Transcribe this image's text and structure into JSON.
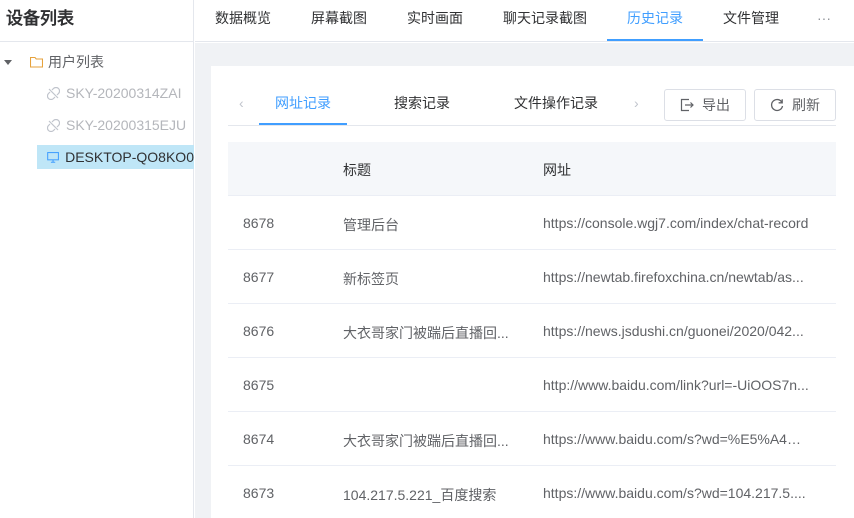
{
  "sidebar": {
    "title": "设备列表",
    "root_label": "用户列表",
    "devices": [
      {
        "label": "SKY-20200314ZAI",
        "status": "offline",
        "icon": "link-broken-icon"
      },
      {
        "label": "SKY-20200315EJU",
        "status": "offline",
        "icon": "link-broken-icon"
      },
      {
        "label": "DESKTOP-QO8KO0",
        "status": "selected",
        "icon": "monitor-icon"
      }
    ]
  },
  "topnav": {
    "items": [
      "数据概览",
      "屏幕截图",
      "实时画面",
      "聊天记录截图",
      "历史记录",
      "文件管理"
    ],
    "more": "···",
    "active_index": 4
  },
  "history": {
    "tabs": [
      "网址记录",
      "搜索记录",
      "文件操作记录"
    ],
    "active_index": 0,
    "prev_arrow": "‹",
    "next_arrow": "›",
    "export_label": "导出",
    "refresh_label": "刷新"
  },
  "table": {
    "columns": [
      "",
      "标题",
      "网址"
    ],
    "rows": [
      {
        "id": "8678",
        "title": "管理后台",
        "url": "https://console.wgj7.com/index/chat-record"
      },
      {
        "id": "8677",
        "title": "新标签页",
        "url": "https://newtab.firefoxchina.cn/newtab/as..."
      },
      {
        "id": "8676",
        "title": "大衣哥家门被踹后直播回...",
        "url": "https://news.jsdushi.cn/guonei/2020/042..."
      },
      {
        "id": "8675",
        "title": "",
        "url": "http://www.baidu.com/link?url=-UiOOS7n..."
      },
      {
        "id": "8674",
        "title": "大衣哥家门被踹后直播回...",
        "url": "https://www.baidu.com/s?wd=%E5%A4%..."
      },
      {
        "id": "8673",
        "title": "104.217.5.221_百度搜索",
        "url": "https://www.baidu.com/s?wd=104.217.5...."
      }
    ]
  },
  "colors": {
    "accent": "#409eff",
    "selected_bg": "#bfe6f7",
    "page_bg": "#f0f2f5",
    "folder": "#e6a23c"
  }
}
